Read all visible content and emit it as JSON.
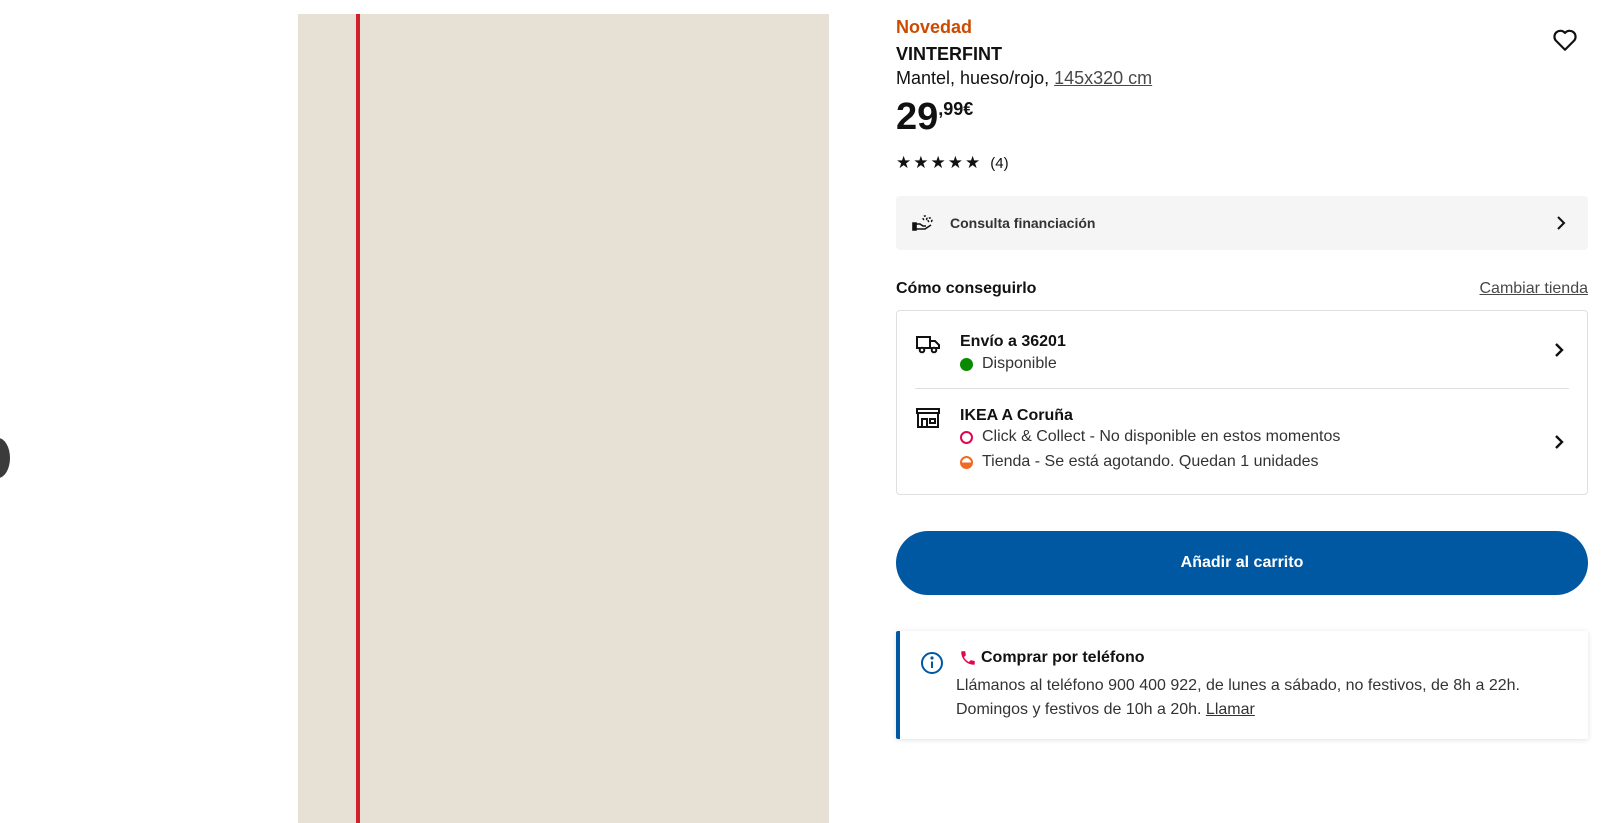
{
  "product": {
    "badge": "Novedad",
    "name": "VINTERFINT",
    "description": "Mantel, hueso/rojo, ",
    "size": "145x320 cm",
    "price_int": "29",
    "price_dec": ",99€",
    "rating_value": 5,
    "rating_max": 5,
    "rating_count": "(4)"
  },
  "finance": {
    "label": "Consulta financiación",
    "icon": "hand-coins-icon"
  },
  "availability": {
    "title": "Cómo conseguirlo",
    "change_store": "Cambiar tienda",
    "delivery": {
      "title": "Envío a 36201",
      "status": "Disponible",
      "status_color": "#0a8a00",
      "icon": "truck-icon"
    },
    "store": {
      "title": "IKEA A Coruña",
      "click_collect": "Click & Collect - No disponible en estos momentos",
      "click_collect_color": "#e00751",
      "instore": "Tienda - Se está agotando. Quedan 1 unidades",
      "instore_color": "#f26a21",
      "icon": "store-icon"
    }
  },
  "cart": {
    "label": "Añadir al carrito",
    "color": "#0058a3"
  },
  "phone": {
    "title": "Comprar por teléfono",
    "text": "Llámanos al teléfono 900 400 922, de lunes a sábado, no festivos, de 8h a 22h. Domingos y festivos de 10h a 20h. ",
    "link": "Llamar"
  },
  "colors": {
    "accent": "#0058a3",
    "badge": "#cc4b00",
    "image_bg": "#e7e0d4",
    "stripe": "#d0202b"
  }
}
